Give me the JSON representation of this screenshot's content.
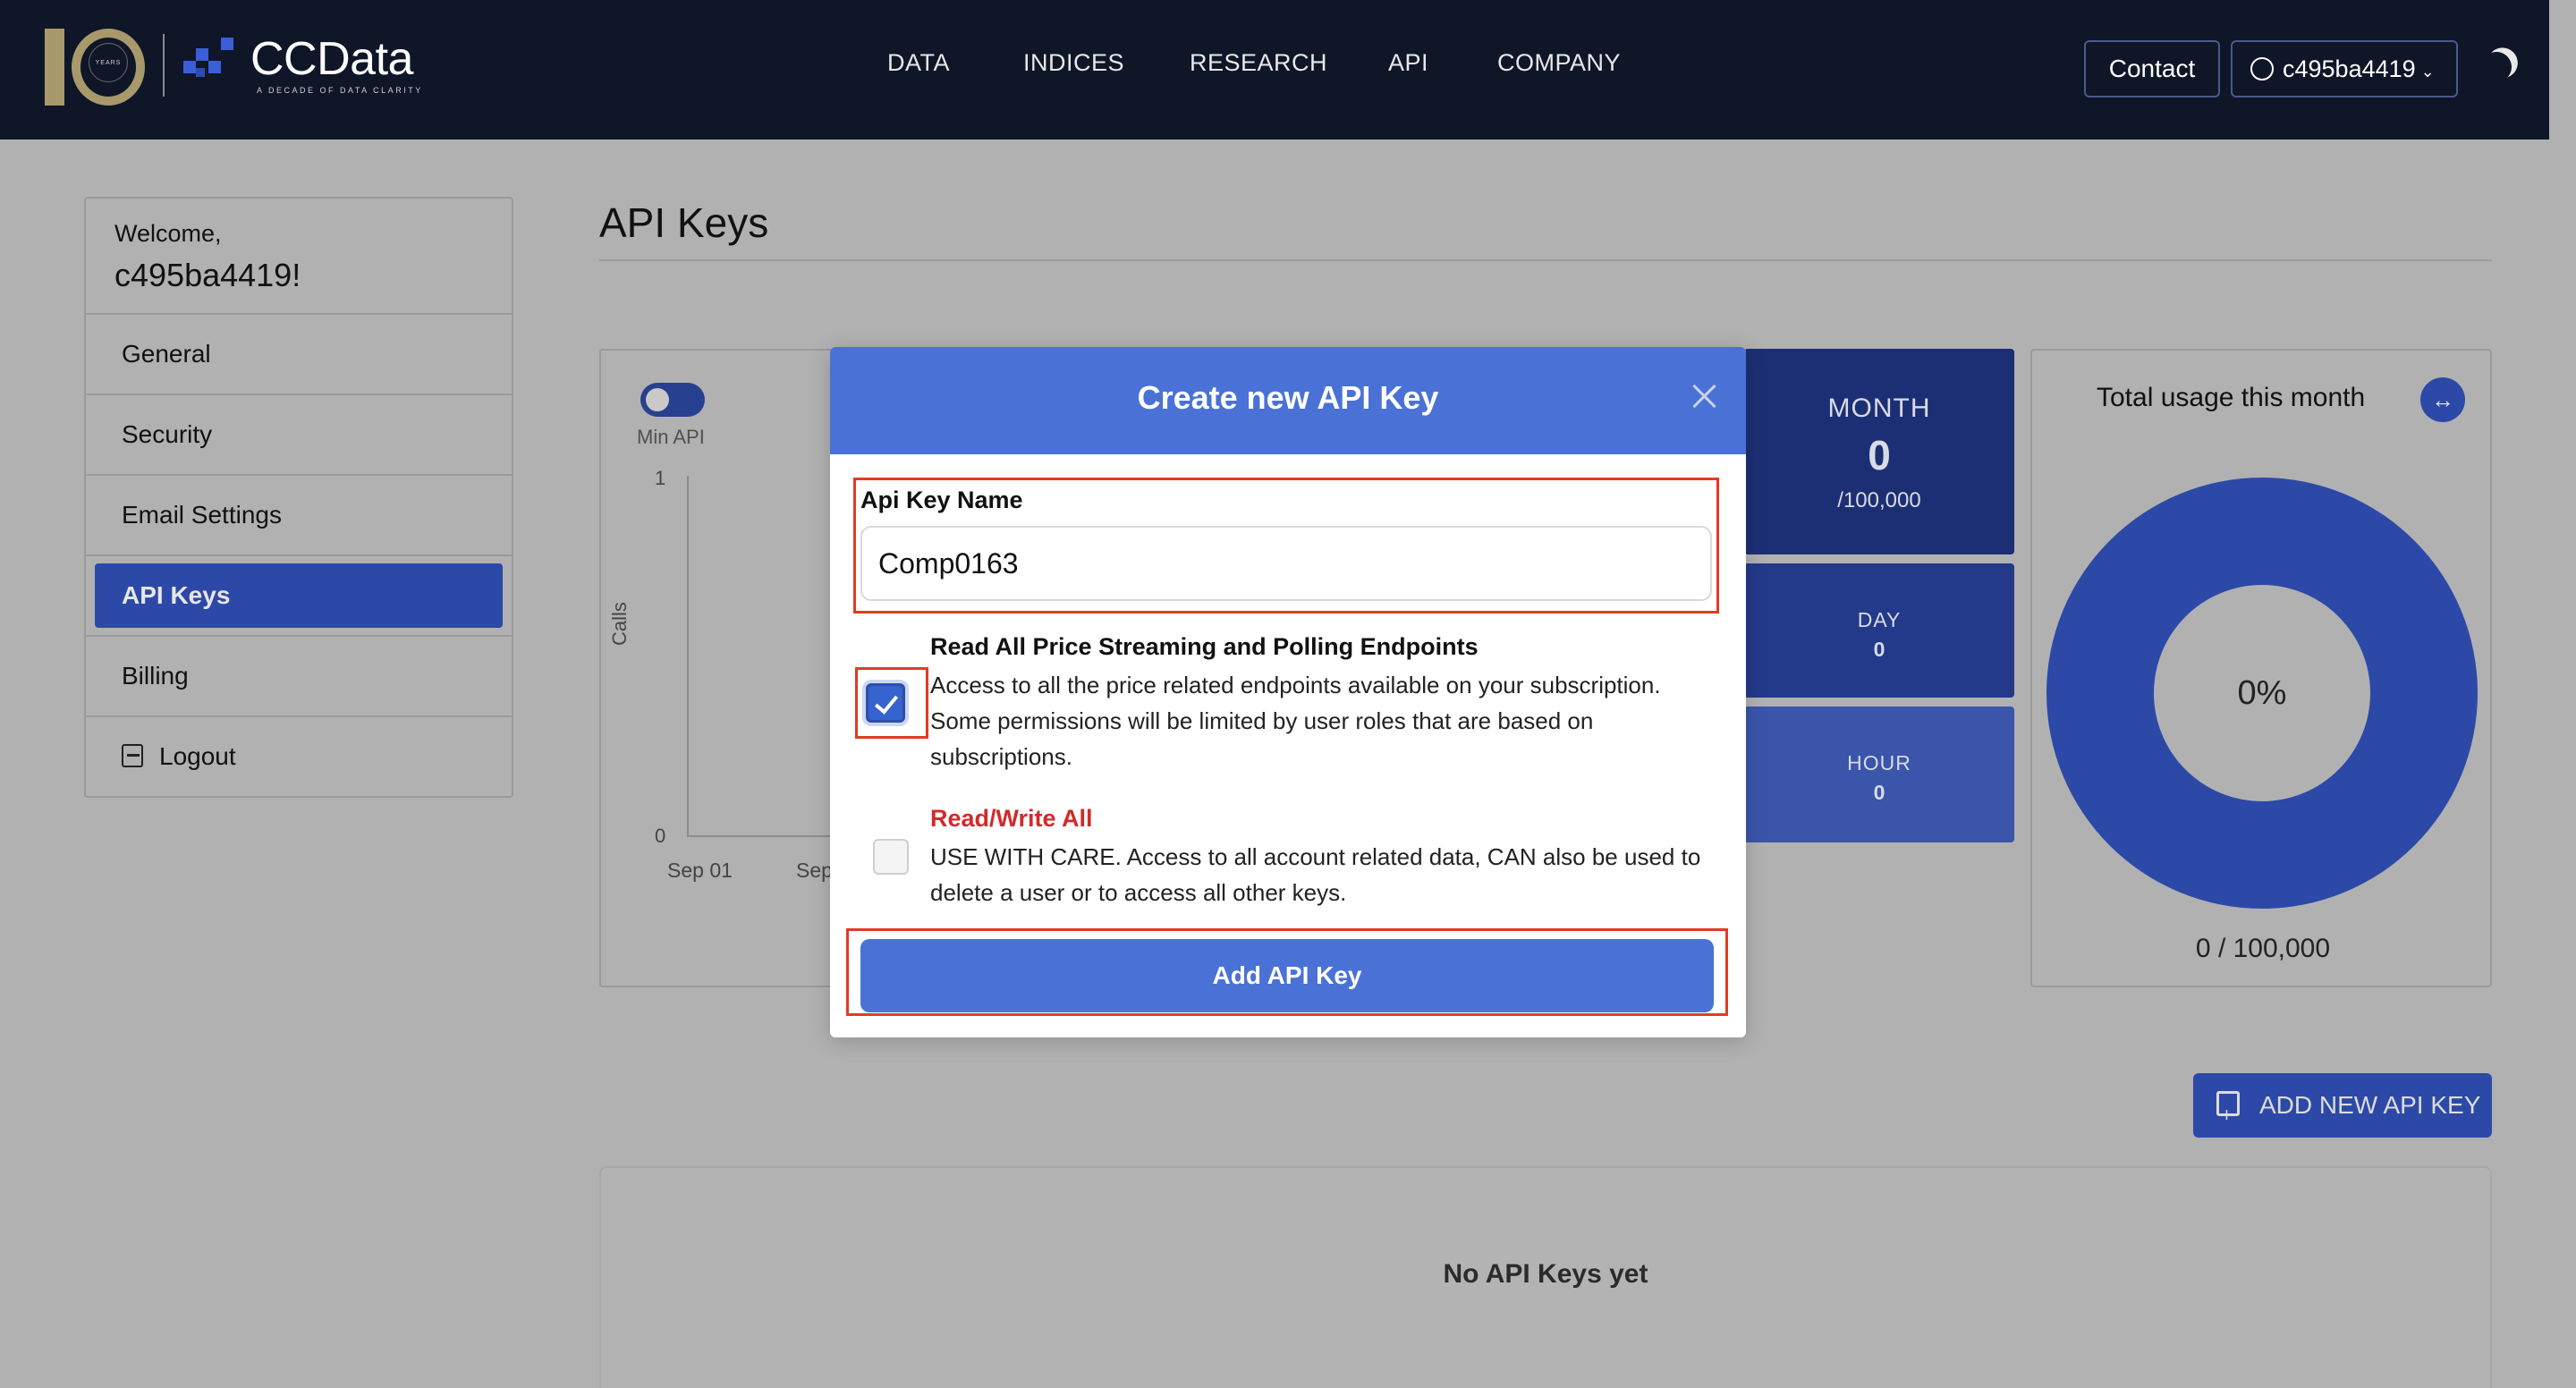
{
  "header": {
    "logo_years": "YEARS",
    "brand": "CCData",
    "tagline": "A DECADE OF DATA CLARITY",
    "nav": [
      "DATA",
      "INDICES",
      "RESEARCH",
      "API",
      "COMPANY"
    ],
    "contact_label": "Contact",
    "user_label": "c495ba4419",
    "brand_color": "#3b5fd9",
    "gold_color": "#a8996b"
  },
  "sidebar": {
    "welcome": "Welcome,",
    "username": "c495ba4419!",
    "items": [
      {
        "label": "General"
      },
      {
        "label": "Security"
      },
      {
        "label": "Email Settings"
      },
      {
        "label": "API Keys",
        "active": true
      },
      {
        "label": "Billing"
      },
      {
        "label": "Logout",
        "icon": "logout-icon"
      }
    ]
  },
  "main": {
    "title": "API Keys",
    "chart": {
      "toggle_label": "Min API",
      "y_label": "Calls",
      "y_ticks": [
        "1",
        "0"
      ],
      "x_ticks": [
        "Sep 01",
        "Sep"
      ]
    },
    "stats": {
      "month_label": "MONTH",
      "month_value": "0",
      "month_limit": "/100,000",
      "day_label": "DAY",
      "day_value": "0",
      "hour_label": "HOUR",
      "hour_value": "0"
    },
    "usage": {
      "title": "Total usage this month",
      "percent": "0%",
      "count": "0 / 100,000"
    },
    "add_key_button": "ADD NEW API KEY",
    "empty_text": "No API Keys yet"
  },
  "modal": {
    "title": "Create new API Key",
    "name_label": "Api Key Name",
    "name_value": "Comp0163",
    "perm1_title": "Read All Price Streaming and Polling Endpoints",
    "perm1_desc": "Access to all the price related endpoints available on your subscription. Some permissions will be limited by user roles that are based on subscriptions.",
    "perm1_checked": true,
    "perm2_title": "Read/Write All",
    "perm2_desc": "USE WITH CARE. Access to all account related data, CAN also be used to delete a user or to access all other keys.",
    "perm2_checked": false,
    "submit_label": "Add API Key",
    "accent_color": "#4a72d6",
    "highlight_color": "#e23b22"
  }
}
